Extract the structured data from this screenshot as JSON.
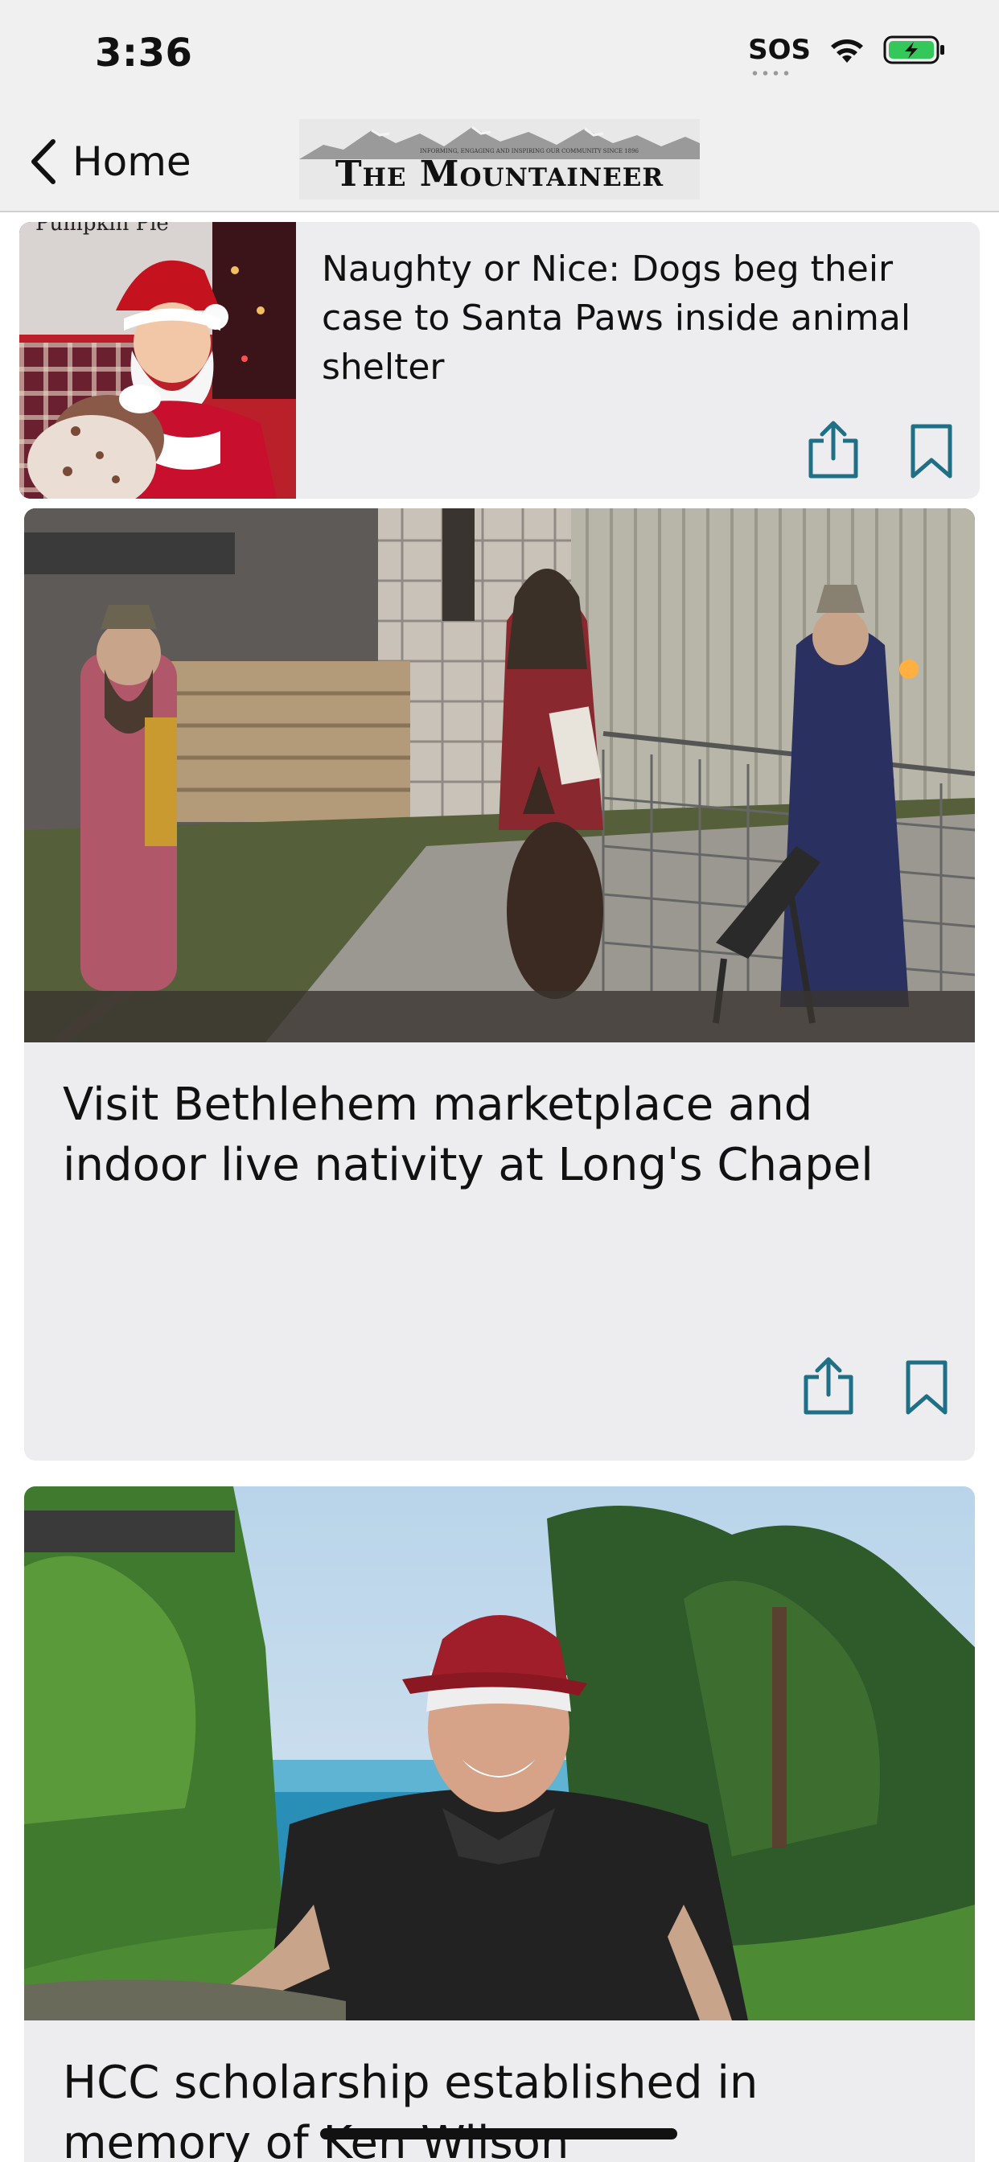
{
  "status_bar": {
    "time": "3:36",
    "sos_label": "SOS",
    "icons": [
      "wifi-icon",
      "battery-charging-icon"
    ],
    "battery_color": "#34c759"
  },
  "nav": {
    "back_label": "Home",
    "logo_text": "The Mountaineer",
    "logo_tagline": "INFORMING, ENGAGING AND INSPIRING OUR COMMUNITY SINCE 1896"
  },
  "accent_color": "#1f6f87",
  "articles": [
    {
      "title": "Naughty or Nice: Dogs beg their case to Santa Paws inside animal shelter",
      "image": "santa-with-dog-photo",
      "actions": [
        "share-icon",
        "bookmark-icon"
      ]
    },
    {
      "title": "Visit Bethlehem marketplace and indoor live nativity at Long's Chapel",
      "image": "live-nativity-photo",
      "actions": [
        "share-icon",
        "bookmark-icon"
      ]
    },
    {
      "title": "HCC scholarship established in memory of Ken Wilson",
      "image": "man-in-red-cap-photo",
      "actions": []
    }
  ]
}
